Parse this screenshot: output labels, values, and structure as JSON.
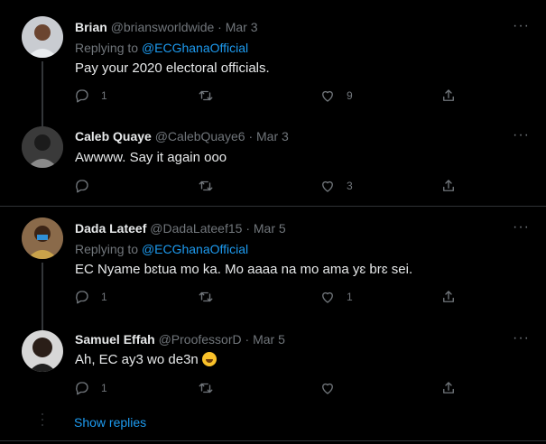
{
  "tweets": [
    {
      "name": "Brian",
      "handle": "@briansworldwide",
      "date": "· Mar 3",
      "replying_prefix": "Replying to ",
      "replying_mention": "@ECGhanaOfficial",
      "text": "Pay your 2020 electoral officials.",
      "reply_count": "1",
      "retweet_count": "",
      "like_count": "9"
    },
    {
      "name": "Caleb Quaye",
      "handle": "@CalebQuaye6",
      "date": "· Mar 3",
      "text": "Awwww. Say it again ooo",
      "reply_count": "",
      "retweet_count": "",
      "like_count": "3"
    },
    {
      "name": "Dada Lateef",
      "handle": "@DadaLateef15",
      "date": "· Mar 5",
      "replying_prefix": "Replying to ",
      "replying_mention": "@ECGhanaOfficial",
      "text": "EC Nyame bɛtua mo ka. Mo aaaa na mo ama yɛ brɛ sei.",
      "reply_count": "1",
      "retweet_count": "",
      "like_count": "1"
    },
    {
      "name": "Samuel Effah",
      "handle": "@ProofessorD",
      "date": "· Mar 5",
      "text": "Ah, EC ay3 wo de3n",
      "reply_count": "1",
      "retweet_count": "",
      "like_count": ""
    }
  ],
  "more_label": "···",
  "show_replies_label": "Show replies",
  "icons": {
    "reply": "reply-icon",
    "retweet": "retweet-icon",
    "like": "heart-icon",
    "share": "share-icon",
    "emoji": "rofl-emoji-icon"
  },
  "colors": {
    "background": "#000000",
    "text": "#e7e9ea",
    "muted": "#71767b",
    "link": "#1d9bf0",
    "divider": "#2f3336"
  }
}
